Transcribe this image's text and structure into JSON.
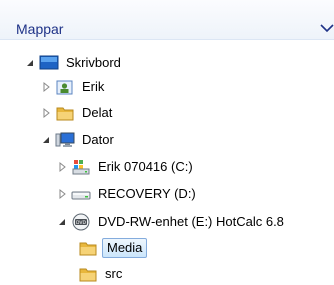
{
  "panel": {
    "title": "Mappar",
    "chevron_icon": "chevron-down-icon"
  },
  "tree": {
    "items": [
      {
        "label": "Skrivbord",
        "icon": "desktop-icon",
        "expander": "expanded"
      },
      {
        "label": "Erik",
        "icon": "user-folder-icon",
        "expander": "collapsed"
      },
      {
        "label": "Delat",
        "icon": "folder-icon",
        "expander": "collapsed"
      },
      {
        "label": "Dator",
        "icon": "computer-icon",
        "expander": "expanded"
      },
      {
        "label": "Erik 070416 (C:)",
        "icon": "windows-drive-icon",
        "expander": "collapsed"
      },
      {
        "label": "RECOVERY (D:)",
        "icon": "drive-icon",
        "expander": "collapsed"
      },
      {
        "label": "DVD-RW-enhet (E:) HotCalc 6.8",
        "icon": "dvd-drive-icon",
        "expander": "expanded"
      },
      {
        "label": "Media",
        "icon": "folder-icon",
        "expander": "none",
        "selected": true
      },
      {
        "label": "src",
        "icon": "folder-icon",
        "expander": "none"
      }
    ]
  },
  "colors": {
    "title": "#1e3287",
    "folder": "#f2c14e",
    "selection_border": "#84acdd"
  }
}
